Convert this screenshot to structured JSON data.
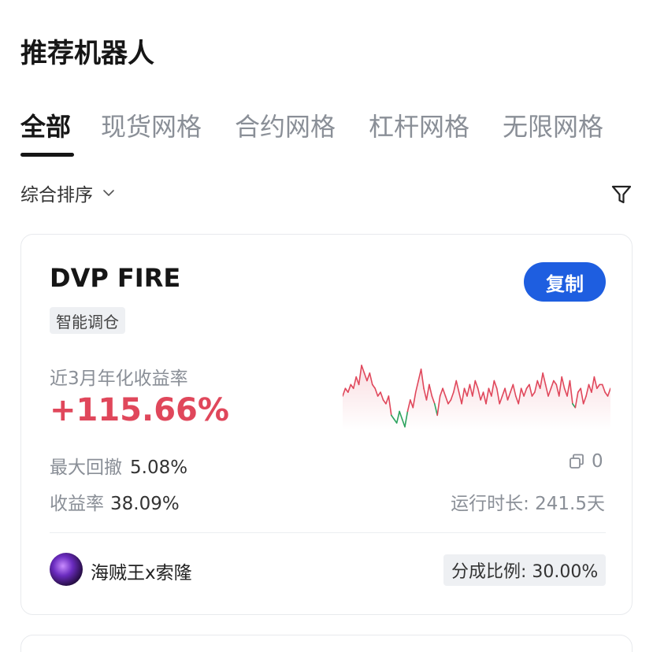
{
  "page": {
    "title": "推荐机器人"
  },
  "tabs": [
    {
      "label": "全部",
      "active": true
    },
    {
      "label": "现货网格",
      "active": false
    },
    {
      "label": "合约网格",
      "active": false
    },
    {
      "label": "杠杆网格",
      "active": false
    },
    {
      "label": "无限网格",
      "active": false
    }
  ],
  "sort": {
    "label": "综合排序"
  },
  "icons": {
    "filter": "filter-icon",
    "sort_chevron": "chevron-down-icon",
    "copies": "copy-icon"
  },
  "colors": {
    "accent": "#1e5ee0",
    "positive": "#e0475b",
    "negative": "#2ca35e"
  },
  "card": {
    "name": "DVP FIRE",
    "copy_label": "复制",
    "tag": "智能调仓",
    "apy_label": "近3月年化收益率",
    "apy_value": "+115.66%",
    "max_drawdown_label": "最大回撤",
    "max_drawdown_value": "5.08%",
    "return_label": "收益率",
    "return_value": "38.09%",
    "copies_count": "0",
    "runtime_text": "运行时长: 241.5天",
    "owner_name": "海贼王x索隆",
    "share_ratio_text": "分成比例: 30.00%",
    "sparkline": [
      52,
      54,
      53,
      55,
      54,
      57,
      55,
      60,
      58,
      56,
      58,
      55,
      54,
      52,
      53,
      51,
      50,
      52,
      47,
      46,
      45,
      48,
      46,
      44,
      48,
      51,
      49,
      53,
      56,
      59,
      54,
      51,
      55,
      52,
      50,
      47,
      52,
      54,
      52,
      50,
      51,
      53,
      56,
      53,
      50,
      54,
      52,
      55,
      52,
      56,
      54,
      51,
      53,
      50,
      54,
      52,
      56,
      54,
      50,
      52,
      54,
      51,
      53,
      55,
      52,
      50,
      54,
      52,
      54,
      55,
      52,
      53,
      56,
      54,
      58,
      55,
      52,
      54,
      56,
      55,
      52,
      57,
      54,
      52,
      56,
      50,
      49,
      53,
      54,
      50,
      52,
      55,
      53,
      57,
      54,
      55,
      55,
      53,
      52,
      54
    ]
  }
}
